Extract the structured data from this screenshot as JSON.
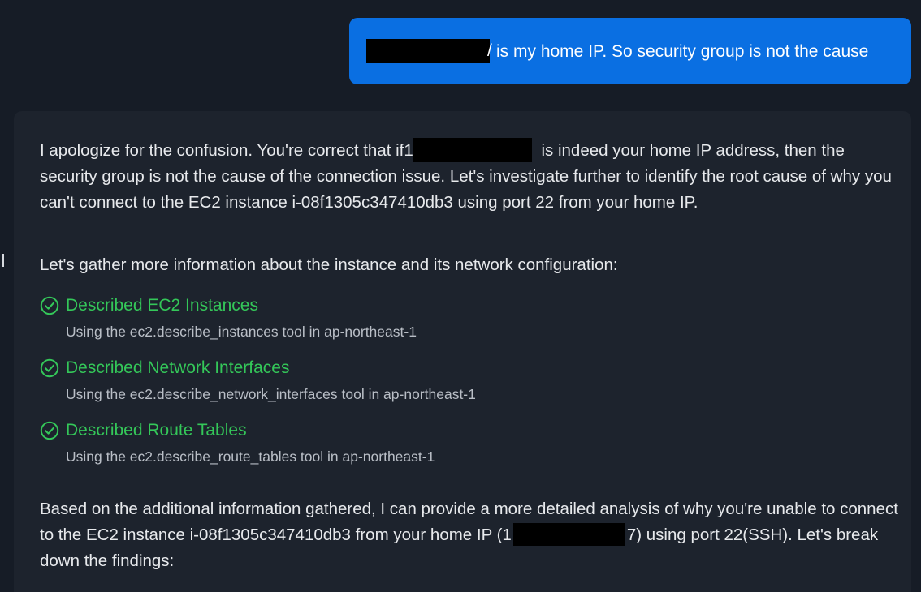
{
  "user_message": {
    "redaction_tail": "/",
    "text": "is my home IP. So security group is not the cause"
  },
  "assistant_message": {
    "paragraph1": {
      "before": "I apologize for the confusion. You're correct that if1",
      "after": " is indeed your home IP address, then the security group is not the cause of the connection issue. Let's investigate further to identify the root cause of why you can't connect to the EC2 instance i-08f1305c347410db3 using port 22 from your home IP."
    },
    "paragraph2": "Let's gather more information about the instance and its network configuration:",
    "tools": [
      {
        "icon": "check-circle-icon",
        "title": "Described EC2 Instances",
        "description": "Using the ec2.describe_instances tool in ap-northeast-1"
      },
      {
        "icon": "check-circle-icon",
        "title": "Described Network Interfaces",
        "description": "Using the ec2.describe_network_interfaces tool in ap-northeast-1"
      },
      {
        "icon": "check-circle-icon",
        "title": "Described Route Tables",
        "description": "Using the ec2.describe_route_tables tool in ap-northeast-1"
      }
    ],
    "paragraph3": {
      "before": "Based on the additional information gathered, I can provide a more detailed analysis of why you're unable to connect to the EC2 instance i-08f1305c347410db3 from your home IP (1",
      "after": "7) using port 22(SSH). Let's break down the findings:"
    }
  },
  "colors": {
    "background": "#161c26",
    "user_bubble": "#0a6fe2",
    "assistant_card": "#1d232d",
    "tool_success": "#34c759"
  }
}
